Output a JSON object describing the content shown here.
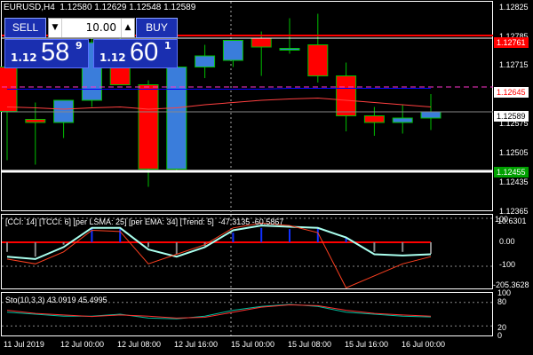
{
  "header": {
    "symbol": "EURUSD,H4",
    "ohlc": "1.12580 1.12629 1.12548 1.12589"
  },
  "trade_panel": {
    "sell_label": "SELL",
    "buy_label": "BUY",
    "lot_value": "10.00",
    "lot_down_icon": "▼",
    "lot_up_icon": "▲",
    "sell_price_prefix": "1.12",
    "sell_price_big": "58",
    "sell_price_sup": "9",
    "buy_price_prefix": "1.12",
    "buy_price_big": "60",
    "buy_price_sup": "1"
  },
  "price_axis": [
    "1.12825",
    "1.12785",
    "1.12715",
    "1.12575",
    "1.12505",
    "1.12435",
    "1.12365"
  ],
  "price_tags": {
    "red_line": "1.12761",
    "pink_line": "1.12645",
    "current": "1.12589",
    "white_line": "1.12455"
  },
  "cci": {
    "label": "[CCI: 14] [TCCI: 6] [per LSMA: 25] [per EMA: 34] [Trend: 5]  -47.3135 -60.5867",
    "axis": [
      "100",
      "10.6301",
      "0.00",
      "-100",
      "-205.3628"
    ],
    "top_label": "100"
  },
  "stoch": {
    "label": "Sto(10,3,3) 43.0919 45.4995",
    "axis": [
      "100",
      "80",
      "20",
      "0"
    ]
  },
  "time_axis": [
    "11 Jul 2019",
    "12 Jul 00:00",
    "12 Jul 08:00",
    "12 Jul 16:00",
    "15 Jul 00:00",
    "15 Jul 08:00",
    "15 Jul 16:00",
    "16 Jul 00:00"
  ],
  "colors": {
    "bull": "#3a7ddb",
    "bear": "#ff0000",
    "wick": "#00c000",
    "ma_blue": "#0000ff",
    "ma_red": "#ff4040",
    "grid": "#ffffff",
    "accent_blue": "#1a2fb0"
  },
  "chart_data": {
    "type": "candlestick",
    "candles": [
      {
        "open": 1.1269,
        "high": 1.1272,
        "low": 1.1248,
        "close": 1.1259
      },
      {
        "open": 1.12572,
        "high": 1.1261,
        "low": 1.1247,
        "close": 1.12565
      },
      {
        "open": 1.12565,
        "high": 1.12615,
        "low": 1.1253,
        "close": 1.12615
      },
      {
        "open": 1.12615,
        "high": 1.1279,
        "low": 1.126,
        "close": 1.12745
      },
      {
        "open": 1.1274,
        "high": 1.1276,
        "low": 1.1265,
        "close": 1.1265
      },
      {
        "open": 1.1265,
        "high": 1.1266,
        "low": 1.1242,
        "close": 1.1246
      },
      {
        "open": 1.1246,
        "high": 1.127,
        "low": 1.12455,
        "close": 1.1269
      },
      {
        "open": 1.1269,
        "high": 1.1274,
        "low": 1.12665,
        "close": 1.12715
      },
      {
        "open": 1.12705,
        "high": 1.1275,
        "low": 1.1269,
        "close": 1.1275
      },
      {
        "open": 1.12755,
        "high": 1.1277,
        "low": 1.1267,
        "close": 1.12735
      },
      {
        "open": 1.1273,
        "high": 1.128,
        "low": 1.1272,
        "close": 1.12732
      },
      {
        "open": 1.1274,
        "high": 1.1281,
        "low": 1.12655,
        "close": 1.1267
      },
      {
        "open": 1.1267,
        "high": 1.127,
        "low": 1.12545,
        "close": 1.1258
      },
      {
        "open": 1.1258,
        "high": 1.126,
        "low": 1.12535,
        "close": 1.12565
      },
      {
        "open": 1.12565,
        "high": 1.12605,
        "low": 1.1254,
        "close": 1.12575
      },
      {
        "open": 1.12575,
        "high": 1.12629,
        "low": 1.12548,
        "close": 1.12589
      }
    ]
  }
}
